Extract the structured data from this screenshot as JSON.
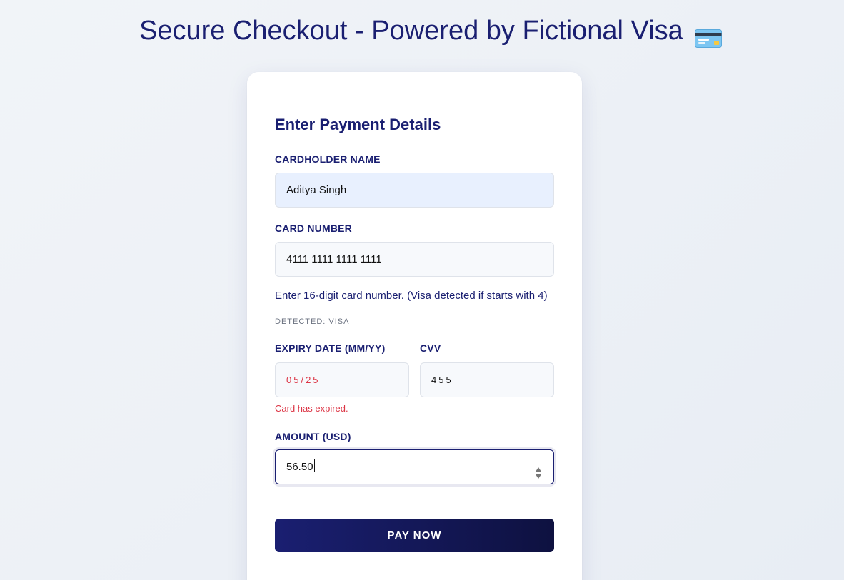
{
  "page": {
    "title": "Secure Checkout - Powered by Fictional Visa",
    "title_icon": "credit-card-emoji"
  },
  "form": {
    "heading": "Enter Payment Details",
    "cardholder": {
      "label": "CARDHOLDER NAME",
      "value": "Aditya Singh"
    },
    "card_number": {
      "label": "CARD NUMBER",
      "value": "4111 1111 1111 1111",
      "helper": "Enter 16-digit card number. (Visa detected if starts with 4)",
      "detected": "DETECTED: VISA"
    },
    "expiry": {
      "label": "EXPIRY DATE (MM/YY)",
      "value": "05/25",
      "error": "Card has expired."
    },
    "cvv": {
      "label": "CVV",
      "value": "455"
    },
    "amount": {
      "label": "AMOUNT (USD)",
      "value": "56.50"
    },
    "submit_label": "PAY NOW"
  },
  "colors": {
    "primary": "#1a1f71",
    "error": "#dc3545",
    "autofill_bg": "#e8f0fe",
    "input_bg": "#f7f9fc"
  }
}
